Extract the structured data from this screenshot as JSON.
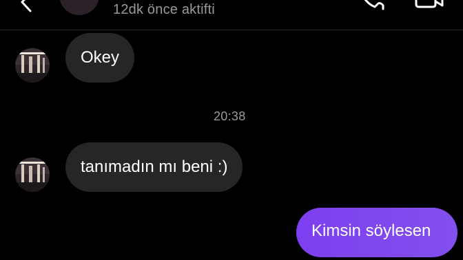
{
  "header": {
    "status": "12dk önce aktifti",
    "icons": {
      "back": "chevron-left-icon",
      "call": "phone-icon",
      "video": "video-camera-icon"
    }
  },
  "messages": [
    {
      "sender": "other",
      "text": "Okey"
    },
    {
      "type": "timestamp",
      "text": "20:38"
    },
    {
      "sender": "other",
      "text": "tanımadın mı beni :)"
    },
    {
      "sender": "me",
      "text": "Kimsin söylesen"
    }
  ],
  "colors": {
    "background": "#000000",
    "incoming_bubble": "#262626",
    "outgoing_bubble": "#7c3ff0",
    "muted_text": "#9a9a9a"
  }
}
